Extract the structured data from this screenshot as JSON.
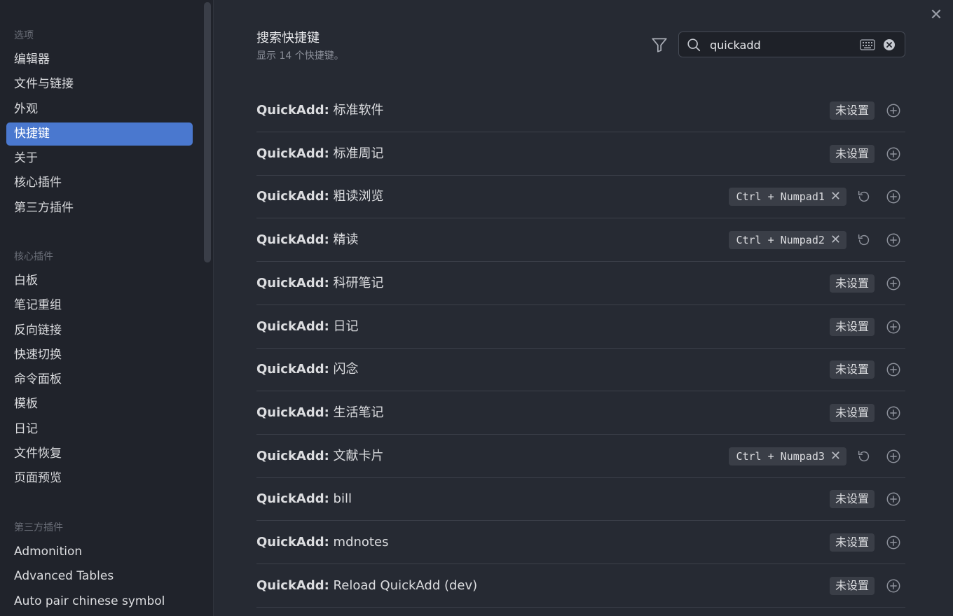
{
  "sidebar": {
    "groups": [
      {
        "title": "选项",
        "items": [
          "编辑器",
          "文件与链接",
          "外观",
          "快捷键",
          "关于",
          "核心插件",
          "第三方插件"
        ]
      },
      {
        "title": "核心插件",
        "items": [
          "白板",
          "笔记重组",
          "反向链接",
          "快速切换",
          "命令面板",
          "模板",
          "日记",
          "文件恢复",
          "页面预览"
        ]
      },
      {
        "title": "第三方插件",
        "items": [
          "Admonition",
          "Advanced Tables",
          "Auto pair chinese symbol"
        ]
      }
    ],
    "active_item": "快捷键"
  },
  "header": {
    "title": "搜索快捷键",
    "subtitle": "显示 14 个快捷键。"
  },
  "search": {
    "value": "quickadd"
  },
  "hotkeys": {
    "unset_label": "未设置",
    "rows": [
      {
        "prefix": "QuickAdd:",
        "name": "标准软件",
        "key": null
      },
      {
        "prefix": "QuickAdd:",
        "name": "标准周记",
        "key": null
      },
      {
        "prefix": "QuickAdd:",
        "name": "粗读浏览",
        "key": "Ctrl + Numpad1"
      },
      {
        "prefix": "QuickAdd:",
        "name": "精读",
        "key": "Ctrl + Numpad2"
      },
      {
        "prefix": "QuickAdd:",
        "name": "科研笔记",
        "key": null
      },
      {
        "prefix": "QuickAdd:",
        "name": "日记",
        "key": null
      },
      {
        "prefix": "QuickAdd:",
        "name": "闪念",
        "key": null
      },
      {
        "prefix": "QuickAdd:",
        "name": "生活笔记",
        "key": null
      },
      {
        "prefix": "QuickAdd:",
        "name": "文献卡片",
        "key": "Ctrl + Numpad3"
      },
      {
        "prefix": "QuickAdd:",
        "name": "bill",
        "key": null
      },
      {
        "prefix": "QuickAdd:",
        "name": "mdnotes",
        "key": null
      },
      {
        "prefix": "QuickAdd:",
        "name": "Reload QuickAdd (dev)",
        "key": null
      }
    ]
  },
  "icons": {
    "close": "close-icon",
    "filter": "filter-icon",
    "search": "search-icon",
    "keyboard": "keyboard-icon",
    "clear": "clear-icon",
    "reset": "reset-icon",
    "add": "add-icon"
  },
  "colors": {
    "accent": "#4a78cf",
    "background": "#262a33",
    "sidebar": "#20232b"
  }
}
